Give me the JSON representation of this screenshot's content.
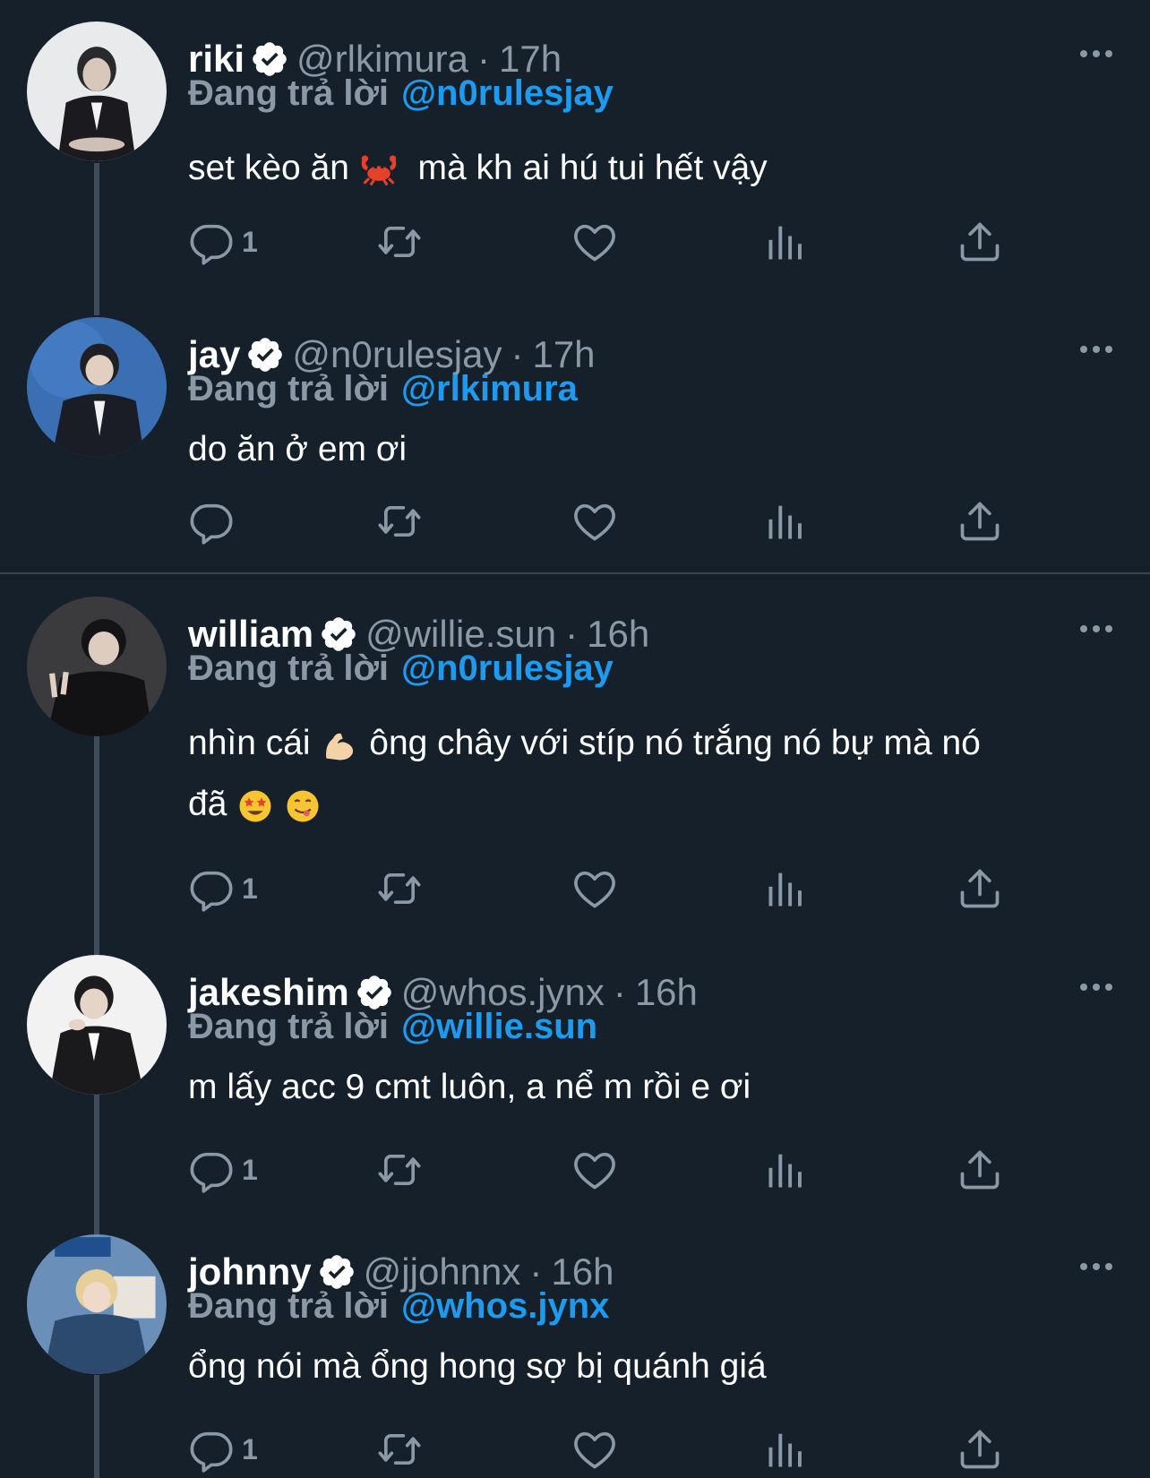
{
  "reply_prefix": "Đang trả lời",
  "tweets": [
    {
      "name": "riki",
      "handle": "@rlkimura",
      "dot": "·",
      "time": "17h",
      "reply_to": "@n0rulesjay",
      "text_before": "set kèo ăn ",
      "emoji1": "crab",
      "text_after": "  mà kh ai hú tui hết vậy",
      "text2": "",
      "reply_count": "1"
    },
    {
      "name": "jay",
      "handle": "@n0rulesjay",
      "dot": "·",
      "time": "17h",
      "reply_to": "@rlkimura",
      "text": "do ăn ở em ơi",
      "reply_count": ""
    },
    {
      "name": "william",
      "handle": "@willie.sun",
      "dot": "·",
      "time": "16h",
      "reply_to": "@n0rulesjay",
      "text_before": "nhìn cái ",
      "emoji1": "flexed-biceps",
      "text_after": " ông chây với stíp nó trắng nó bự mà nó",
      "text2": "đã ",
      "reply_count": "1"
    },
    {
      "name": "jakeshim",
      "handle": "@whos.jynx",
      "dot": "·",
      "time": "16h",
      "reply_to": "@willie.sun",
      "text": "m lấy acc 9 cmt luôn, a nể m rồi e ơi",
      "reply_count": "1"
    },
    {
      "name": "johnny",
      "handle": "@jjohnnx",
      "dot": "·",
      "time": "16h",
      "reply_to": "@whos.jynx",
      "text": "ổng nói mà ổng hong sợ bị quánh giá",
      "reply_count": "1"
    }
  ],
  "colors": {
    "bg": "#15202b",
    "muted": "#8b98a5",
    "link": "#1d9bf0",
    "line": "#3d4d5c"
  },
  "icons": [
    "verified-badge-icon",
    "reply-icon",
    "retweet-icon",
    "like-icon",
    "views-icon",
    "share-icon",
    "more-icon"
  ]
}
